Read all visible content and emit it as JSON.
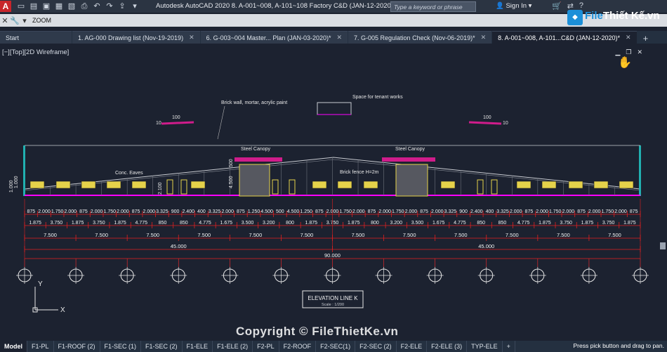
{
  "app": {
    "logo_letter": "A",
    "title": "Autodesk AutoCAD 2020   8. A-001~008, A-101~108 Factory C&D (JAN-12-2020).dwg",
    "search_placeholder": "Type a keyword or phrase",
    "sign_in": "Sign In",
    "brand_file": "File",
    "brand_rest": "Thiết Kế.vn"
  },
  "command": {
    "text": "ZOOM"
  },
  "tabs": [
    {
      "label": "Start",
      "closable": false
    },
    {
      "label": "1. AG-000 Drawing list (Nov-19-2019)",
      "closable": true
    },
    {
      "label": "6. G-003~004 Master... Plan (JAN-03-2020)*",
      "closable": true
    },
    {
      "label": "7. G-005 Regulation Check (Nov-06-2019)*",
      "closable": true
    },
    {
      "label": "8. A-001~008, A-101...C&D (JAN-12-2020)*",
      "closable": true
    }
  ],
  "viewport": {
    "label": "[−][Top][2D Wireframe]"
  },
  "drawing": {
    "annotations": {
      "brick_wall": "Brick wall, mortar, acrylic paint",
      "tenant": "Space for tenant works",
      "canopy_left": "Steel Canopy",
      "canopy_right": "Steel Canopy",
      "eaves": "Conc. Eaves",
      "fence": "Brick fence H=2m",
      "slope_left_top": "100",
      "slope_left_side": "10",
      "slope_right_top": "100",
      "slope_right_side": "10",
      "h1": "1.000",
      "h2": "1.000",
      "h3": "2.100",
      "h4": "4.500",
      "h5": "500"
    },
    "dim_row1": [
      "875",
      "2.000",
      "1.750",
      "2.000",
      "875",
      "2.000",
      "1.750",
      "2.000",
      "875",
      "2.000",
      "3.325",
      "900",
      "2.400",
      "400",
      "3.325",
      "2.000",
      "875",
      "1.250",
      "4.500",
      "500",
      "4.500",
      "1.250",
      "875",
      "2.000",
      "1.750",
      "2.000",
      "875",
      "2.000",
      "1.750",
      "2.000",
      "875",
      "2.000",
      "3.325",
      "900",
      "2.400",
      "400",
      "3.325",
      "2.000",
      "875",
      "2.000",
      "1.750",
      "2.000",
      "875",
      "2.000",
      "1.750",
      "2.000",
      "875"
    ],
    "dim_row2": [
      "1.875",
      "3.750",
      "1.875",
      "3.750",
      "1.875",
      "4.775",
      "850",
      "850",
      "4.775",
      "1.675",
      "3.500",
      "3.200",
      "800",
      "1.875",
      "3.750",
      "1.875",
      "800",
      "3.200",
      "3.500",
      "1.675",
      "4.775",
      "850",
      "850",
      "4.775",
      "1.875",
      "3.750",
      "1.875",
      "3.750",
      "1.875"
    ],
    "dim_row3": [
      "7.500",
      "7.500",
      "7.500",
      "7.500",
      "7.500",
      "7.500",
      "7.500",
      "7.500",
      "7.500",
      "7.500",
      "7.500",
      "7.500"
    ],
    "dim_row4": [
      "45.000",
      "45.000"
    ],
    "dim_total": "90.000",
    "grid_count": 13,
    "title_box": {
      "title": "ELEVATION LINE K",
      "scale": "Scale : 1/200"
    },
    "ucs_x": "X",
    "ucs_y": "Y"
  },
  "layout_tabs": [
    "Model",
    "F1-PL",
    "F1-ROOF (2)",
    "F1-SEC (1)",
    "F1-SEC (2)",
    "F1-ELE",
    "F1-ELE (2)",
    "F2-PL",
    "F2-ROOF",
    "F2-SEC(1)",
    "F2-SEC (2)",
    "F2-ELE",
    "F2-ELE (3)",
    "TYP-ELE"
  ],
  "status_prompt": "Press pick button and drag to pan.",
  "watermark": "Copyright © FileThietKe.vn",
  "colors": {
    "background": "#1c2230",
    "dimension": "#e02020",
    "facade": "#c9ccd2",
    "ground": "#ff00ff",
    "canopy": "#d01c8b",
    "window_fill": "#e5d24a",
    "grid_line": "#ff2a2a"
  }
}
